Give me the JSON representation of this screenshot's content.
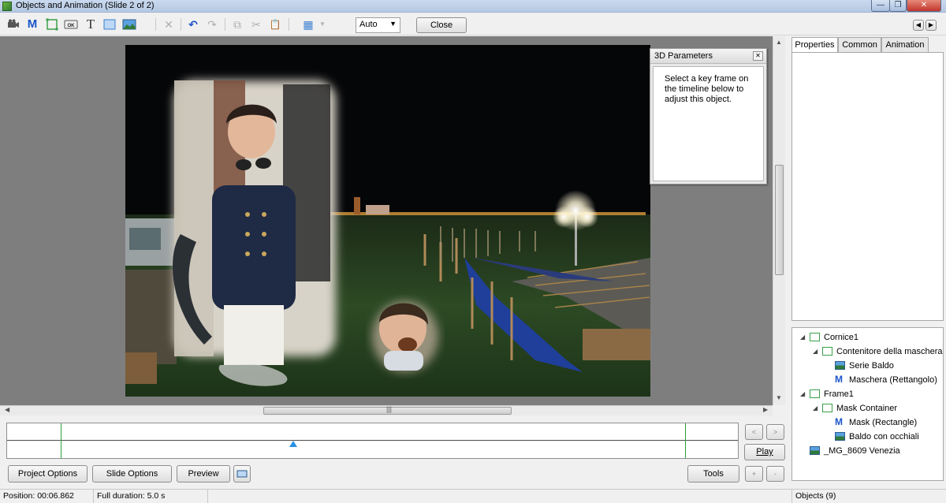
{
  "window": {
    "title": "Objects and Animation  (Slide 2 of 2)",
    "controls": {
      "minimize": "—",
      "maximize": "❐",
      "close": "✕"
    }
  },
  "toolbar": {
    "tools": [
      {
        "name": "camera-icon",
        "glyph": "🎥"
      },
      {
        "name": "mask-tool-icon",
        "glyph": "M"
      },
      {
        "name": "frame-tool-icon",
        "glyph": ""
      },
      {
        "name": "button-tool-icon",
        "glyph": "OK"
      },
      {
        "name": "text-tool-icon",
        "glyph": "T"
      },
      {
        "name": "rectangle-tool-icon",
        "glyph": ""
      },
      {
        "name": "image-tool-icon",
        "glyph": ""
      }
    ],
    "actions": [
      {
        "name": "delete-icon",
        "glyph": "✕"
      },
      {
        "name": "undo-icon",
        "glyph": "↶"
      },
      {
        "name": "redo-icon",
        "glyph": "↷"
      },
      {
        "name": "copy-icon",
        "glyph": "⧉"
      },
      {
        "name": "cut-icon",
        "glyph": "✂"
      },
      {
        "name": "paste-icon",
        "glyph": "📋"
      },
      {
        "name": "grid-icon",
        "glyph": "▦"
      }
    ],
    "zoom_value": "Auto",
    "close_label": "Close"
  },
  "params_panel": {
    "title": "3D Parameters",
    "message": "Select a key frame on the timeline below to adjust this object."
  },
  "tabs": [
    {
      "label": "Properties",
      "active": true
    },
    {
      "label": "Common",
      "active": false
    },
    {
      "label": "Animation",
      "active": false
    }
  ],
  "tree": [
    {
      "label": "Cornice1",
      "level": 0,
      "icon": "frame",
      "expanded": true
    },
    {
      "label": "Contenitore della maschera",
      "level": 1,
      "icon": "frame",
      "expanded": true
    },
    {
      "label": "Serie Baldo",
      "level": 2,
      "icon": "image"
    },
    {
      "label": "Maschera (Rettangolo)",
      "level": 2,
      "icon": "mask"
    },
    {
      "label": "Frame1",
      "level": 0,
      "icon": "frame",
      "expanded": true
    },
    {
      "label": "Mask Container",
      "level": 1,
      "icon": "frame",
      "expanded": true
    },
    {
      "label": "Mask (Rectangle)",
      "level": 2,
      "icon": "mask"
    },
    {
      "label": "Baldo con occhiali",
      "level": 2,
      "icon": "image"
    },
    {
      "label": "_MG_8609 Venezia",
      "level": 0,
      "icon": "image"
    }
  ],
  "timeline": {
    "prev": "<",
    "next": ">",
    "play_label": "Play",
    "add": "+",
    "remove": "-"
  },
  "buttons": {
    "project_options": "Project Options",
    "slide_options": "Slide Options",
    "preview": "Preview",
    "tools": "Tools"
  },
  "status": {
    "position": "Position:  00:06.862",
    "duration": "Full duration:  5.0 s",
    "objects": "Objects (9)"
  },
  "colors": {
    "accent_blue": "#2a90e0",
    "timeline_green": "#2e9e3c"
  }
}
